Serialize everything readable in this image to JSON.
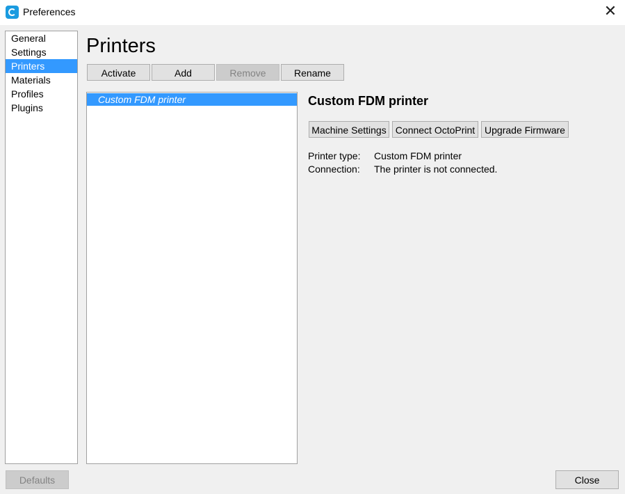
{
  "window": {
    "title": "Preferences"
  },
  "sidebar": {
    "items": [
      {
        "label": "General"
      },
      {
        "label": "Settings"
      },
      {
        "label": "Printers"
      },
      {
        "label": "Materials"
      },
      {
        "label": "Profiles"
      },
      {
        "label": "Plugins"
      }
    ],
    "selected": "Printers"
  },
  "page": {
    "title": "Printers"
  },
  "toolbar": {
    "activate": "Activate",
    "add": "Add",
    "remove": "Remove",
    "rename": "Rename"
  },
  "printer_list": {
    "items": [
      {
        "label": "Custom FDM printer"
      }
    ],
    "selected": "Custom FDM printer"
  },
  "details": {
    "name": "Custom FDM printer",
    "buttons": {
      "machine_settings": "Machine Settings",
      "connect_octoprint": "Connect OctoPrint",
      "upgrade_firmware": "Upgrade Firmware"
    },
    "printer_type_label": "Printer type:",
    "printer_type_value": "Custom FDM printer",
    "connection_label": "Connection:",
    "connection_value": "The printer is not connected."
  },
  "footer": {
    "defaults": "Defaults",
    "close": "Close"
  },
  "colors": {
    "selection": "#3399ff",
    "app_icon": "#1a9be0"
  },
  "icons": {
    "app": "cura-logo-icon",
    "close": "close-icon"
  }
}
